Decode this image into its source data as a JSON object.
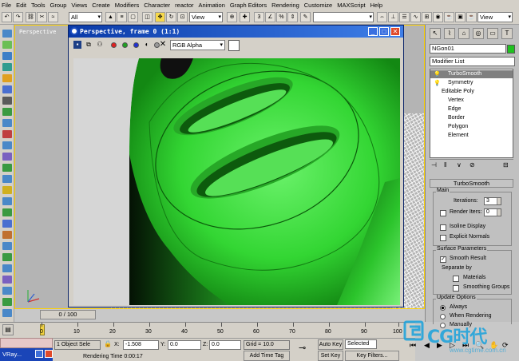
{
  "menu": [
    "File",
    "Edit",
    "Tools",
    "Group",
    "Views",
    "Create",
    "Modifiers",
    "Character",
    "reactor",
    "Animation",
    "Graph Editors",
    "Rendering",
    "Customize",
    "MAXScript",
    "Help"
  ],
  "toolbar": {
    "filter_select": "All",
    "view_select_1": "View",
    "view_select_2": "View"
  },
  "viewport": {
    "label": "Perspective"
  },
  "frame_window": {
    "title": "Perspective, frame 0 (1:1)",
    "channel_select": "RGB Alpha",
    "minimize": "_",
    "maximize": "□",
    "close": "✕"
  },
  "command_panel": {
    "object_name": "NGon01",
    "object_color": "#1fc21f",
    "modifier_list": "Modifier List",
    "stack": [
      "TurboSmooth",
      "Symmetry",
      "Editable Poly",
      "Vertex",
      "Edge",
      "Border",
      "Polygon",
      "Element"
    ],
    "rollout_title": "TurboSmooth",
    "main_group": "Main",
    "iterations_label": "Iterations:",
    "iterations_value": "3",
    "render_iters_label": "Render Iters:",
    "render_iters_value": "0",
    "isoline_label": "Isoline Display",
    "explicit_normals_label": "Explicit Normals",
    "surface_group": "Surface Parameters",
    "smooth_result_label": "Smooth Result",
    "separate_by_label": "Separate by",
    "materials_label": "Materials",
    "smoothing_groups_label": "Smoothing Groups",
    "update_group": "Update Options",
    "always_label": "Always",
    "when_rendering_label": "When Rendering",
    "manually_label": "Manually"
  },
  "timeline": {
    "slider_label": "0 / 100",
    "ticks": [
      "0",
      "10",
      "20",
      "30",
      "40",
      "50",
      "60",
      "70",
      "80",
      "90",
      "100"
    ]
  },
  "status": {
    "selection": "1 Object Sele",
    "x_label": "X:",
    "x_value": "-1.508",
    "y_label": "Y:",
    "y_value": "0.0",
    "z_label": "Z:",
    "z_value": "0.0",
    "grid": "Grid = 10.0",
    "auto_key": "Auto Key",
    "selected": "Selected",
    "set_key": "Set Key",
    "key_filters": "Key Filters...",
    "render_time": "Rendering Time  0:00:17",
    "add_time_tag": "Add Time Tag"
  },
  "taskbar": {
    "item": "VRay..."
  },
  "watermark": {
    "text": "CG时代",
    "url": "www.cgtime.com.cn"
  }
}
